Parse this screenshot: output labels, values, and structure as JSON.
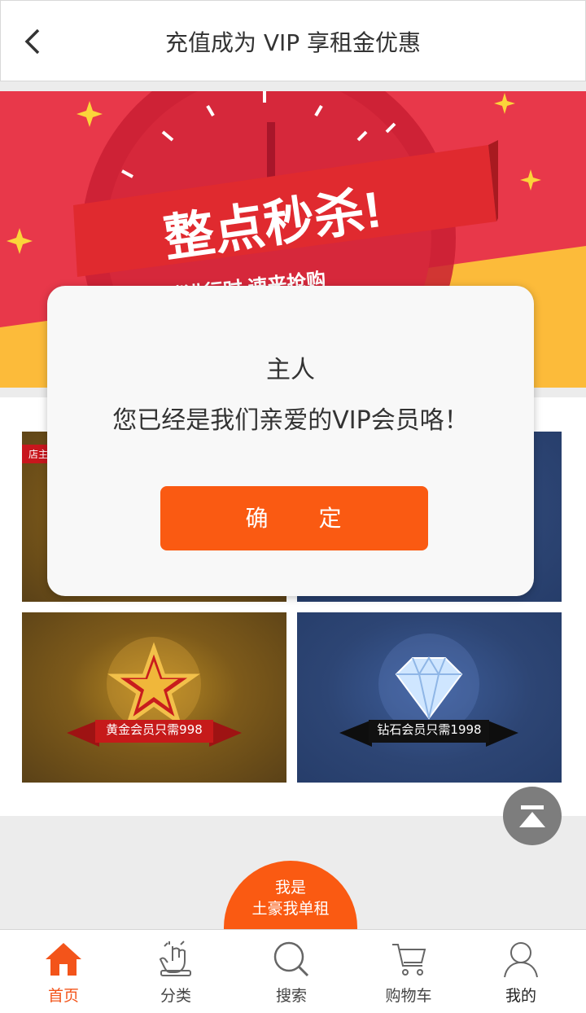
{
  "header": {
    "title": "充值成为 VIP 享租金优惠",
    "back_icon": "chevron-left-icon"
  },
  "banner": {
    "headline": "整点秒杀!",
    "subline": "低价促销进行时 速来抢购",
    "colors": {
      "red": "#e8384a",
      "yellow": "#fcbb3a"
    }
  },
  "tiles": {
    "shop_tag": "店主",
    "gold": {
      "label": "黄金会员只需998"
    },
    "diamond": {
      "label": "钻石会员只需1998"
    }
  },
  "rich_button": {
    "line1": "我是",
    "line2": "土豪我单租"
  },
  "dialog": {
    "title": "主人",
    "message": "您已经是我们亲爱的VIP会员咯！",
    "confirm": "确　　定"
  },
  "tabbar": {
    "items": [
      {
        "label": "首页",
        "icon": "home-icon",
        "active": true
      },
      {
        "label": "分类",
        "icon": "category-icon",
        "active": false
      },
      {
        "label": "搜索",
        "icon": "search-icon",
        "active": false
      },
      {
        "label": "购物车",
        "icon": "cart-icon",
        "active": false
      },
      {
        "label": "我的",
        "icon": "user-icon",
        "active": false
      }
    ]
  },
  "accent_color": "#fa5a12"
}
